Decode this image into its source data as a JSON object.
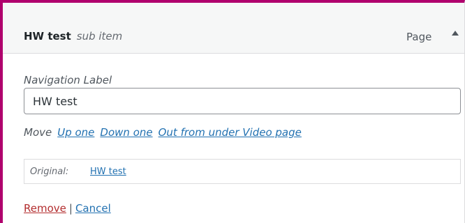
{
  "item": {
    "title": "HW test",
    "subtitle": "sub item",
    "type": "Page"
  },
  "navigation_label": {
    "label": "Navigation Label",
    "value": "HW test"
  },
  "move": {
    "label": "Move",
    "links": [
      "Up one",
      "Down one",
      "Out from under Video page"
    ]
  },
  "original": {
    "label": "Original:",
    "link": "HW test"
  },
  "actions": {
    "remove": "Remove",
    "separator": "|",
    "cancel": "Cancel"
  },
  "colors": {
    "accent_border": "#b0006d",
    "link": "#2271b1",
    "remove": "#b32d2e"
  },
  "icons": {
    "toggle": "triangle-up-icon"
  }
}
